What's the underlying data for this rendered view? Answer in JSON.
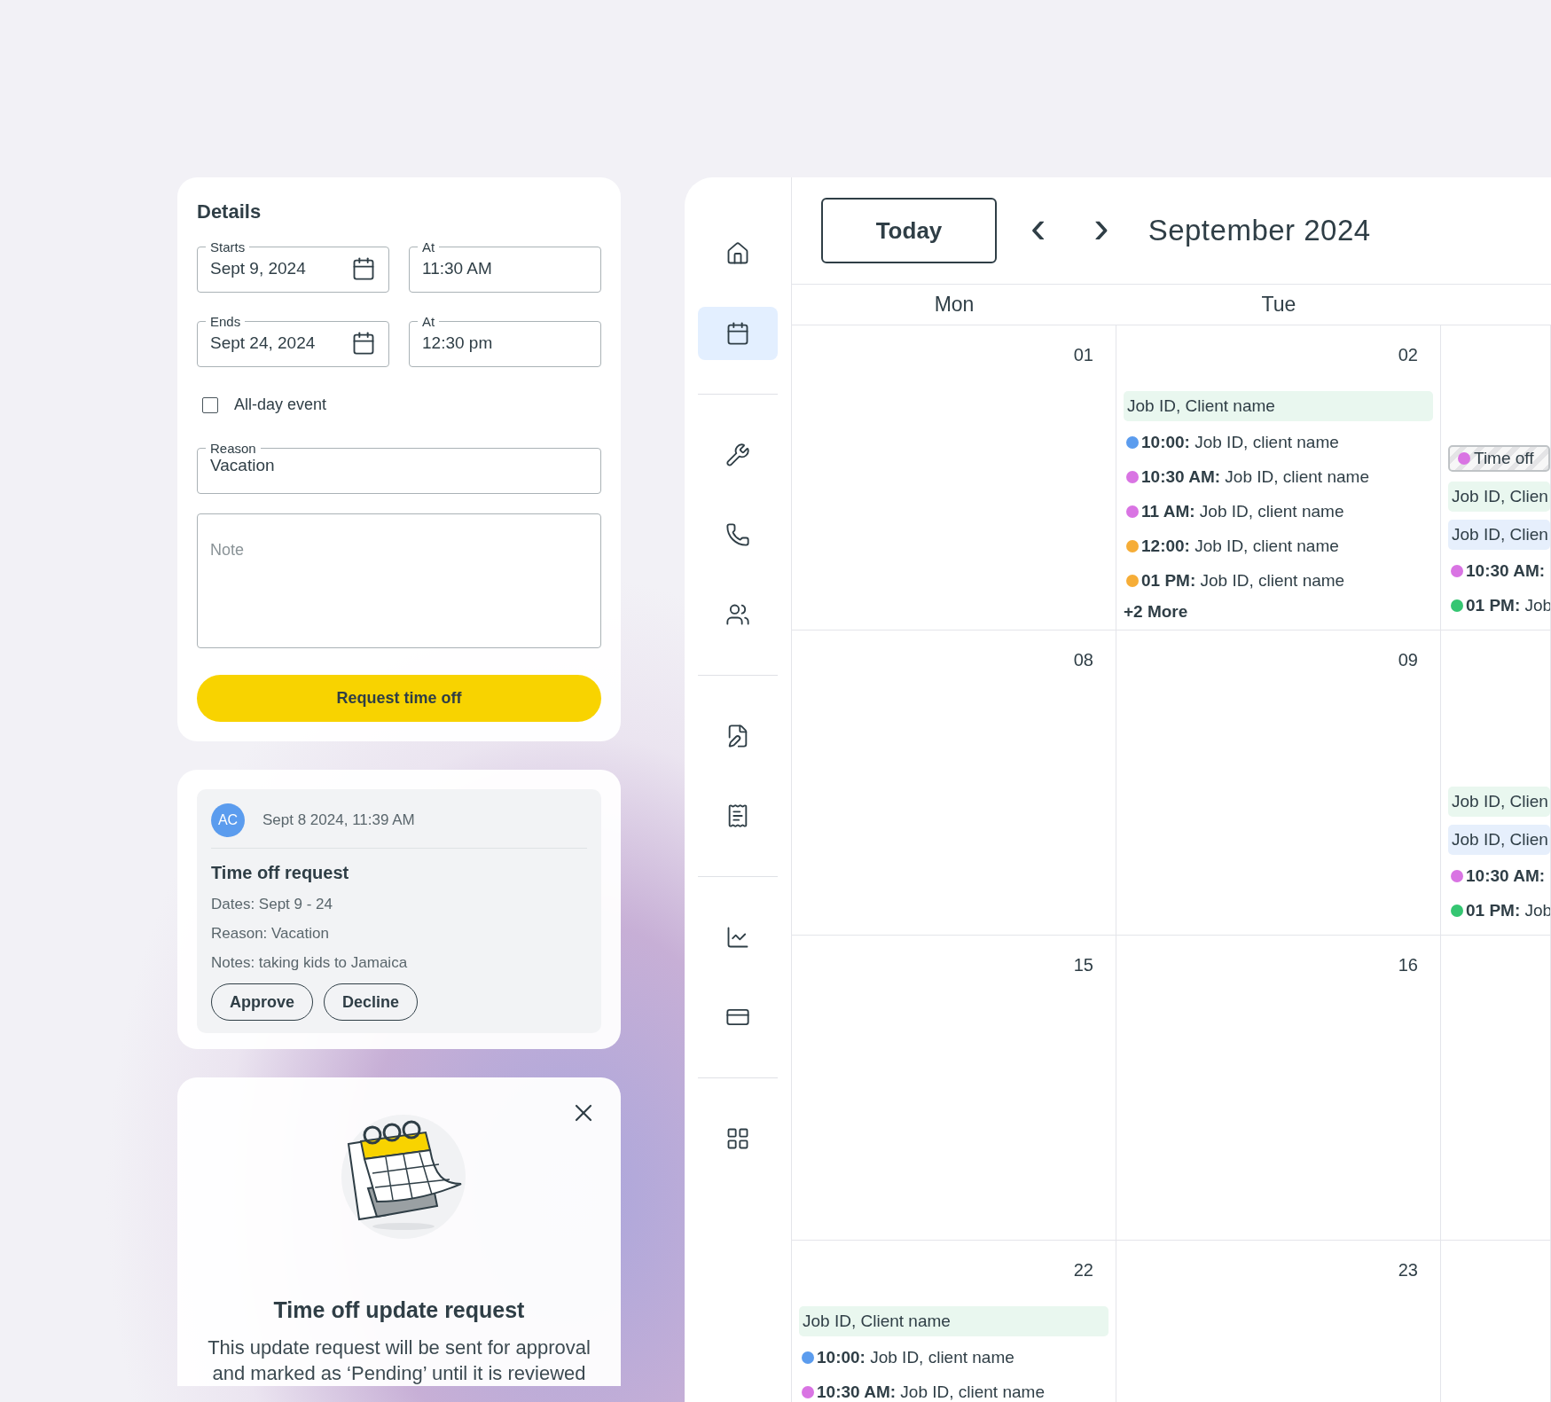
{
  "details": {
    "title": "Details",
    "starts": {
      "label": "Starts",
      "value": "Sept 9, 2024"
    },
    "starts_at": {
      "label": "At",
      "value": "11:30 AM"
    },
    "ends": {
      "label": "Ends",
      "value": "Sept 24, 2024"
    },
    "ends_at": {
      "label": "At",
      "value": "12:30 pm"
    },
    "all_day": {
      "label": "All-day event",
      "checked": false
    },
    "reason": {
      "label": "Reason",
      "value": "Vacation"
    },
    "note": {
      "placeholder": "Note"
    },
    "submit": "Request time off"
  },
  "request_card": {
    "avatar": "AC",
    "timestamp": "Sept 8 2024, 11:39 AM",
    "title": "Time off request",
    "lines": [
      "Dates: Sept 9 - 24",
      "Reason: Vacation",
      "Notes: taking kids to Jamaica"
    ],
    "buttons": [
      "Approve",
      "Decline"
    ]
  },
  "update_modal": {
    "title": "Time off update request",
    "message": "This update request will be sent for approval and marked as ‘Pending’ until it is reviewed"
  },
  "nav_groups": [
    {
      "items": [
        {
          "selected": false
        },
        {
          "selected": true
        }
      ]
    },
    {
      "items": [
        {
          "selected": false
        },
        {
          "selected": false
        },
        {
          "selected": false
        }
      ]
    },
    {
      "items": [
        {
          "selected": false
        },
        {
          "selected": false
        }
      ]
    },
    {
      "items": [
        {
          "selected": false
        },
        {
          "selected": false
        }
      ]
    },
    {
      "items": [
        {
          "selected": false
        }
      ]
    }
  ],
  "calendar": {
    "today": "Today",
    "prev": "‹",
    "next": "›",
    "month": "September 2024",
    "weekdays": [
      "Mon",
      "Tue"
    ],
    "weeks": [
      {
        "cells": [
          {
            "day": "01"
          },
          {
            "day": "02",
            "events": [
              {
                "kind": "block",
                "color": "#e9f7ef",
                "text": "Job ID, Client name"
              },
              {
                "kind": "timed",
                "color": "#5b9cee",
                "text": "**10:00:** Job ID, client name"
              },
              {
                "kind": "timed",
                "color": "#d974e3",
                "text": "**10:30 AM:** Job ID, client name"
              },
              {
                "kind": "timed",
                "color": "#d974e3",
                "text": "**11 AM:** Job ID, client name"
              },
              {
                "kind": "timed",
                "color": "#f6ad37",
                "text": "**12:00:** Job ID, client name"
              },
              {
                "kind": "timed",
                "color": "#f6ad37",
                "text": "**01 PM:** Job ID, client name"
              },
              {
                "kind": "more",
                "text": "+2 More"
              }
            ]
          },
          {
            "events": [
              {
                "kind": "timeoff",
                "color": "#d974e3",
                "text": "Time off"
              },
              {
                "kind": "block",
                "color": "#e9f7ef",
                "text": "Job ID, Clien"
              },
              {
                "kind": "block",
                "color": "#e6effc",
                "text": "Job ID, Clien"
              },
              {
                "kind": "timed",
                "color": "#d974e3",
                "text": "**10:30 AM:**"
              },
              {
                "kind": "timed",
                "color": "#35c672",
                "text": "**01 PM:** Job"
              }
            ]
          }
        ]
      },
      {
        "cells": [
          {
            "day": "08"
          },
          {
            "day": "09"
          },
          {
            "events": [
              {
                "kind": "block",
                "color": "#e9f7ef",
                "text": "Job ID, Clien"
              },
              {
                "kind": "block",
                "color": "#e6effc",
                "text": "Job ID, Clien"
              },
              {
                "kind": "timed",
                "color": "#d974e3",
                "text": "**10:30 AM:**"
              },
              {
                "kind": "timed",
                "color": "#35c672",
                "text": "**01 PM:** Job"
              }
            ]
          }
        ]
      },
      {
        "cells": [
          {
            "day": "15"
          },
          {
            "day": "16"
          },
          {}
        ]
      },
      {
        "cells": [
          {
            "day": "22",
            "events": [
              {
                "kind": "block",
                "color": "#e9f7ef",
                "text": "Job ID, Client name"
              },
              {
                "kind": "timed",
                "color": "#5b9cee",
                "text": "**10:00:** Job ID, client name"
              },
              {
                "kind": "timed",
                "color": "#d974e3",
                "text": "**10:30 AM:** Job ID, client name"
              }
            ]
          },
          {
            "day": "23"
          },
          {}
        ]
      }
    ]
  }
}
